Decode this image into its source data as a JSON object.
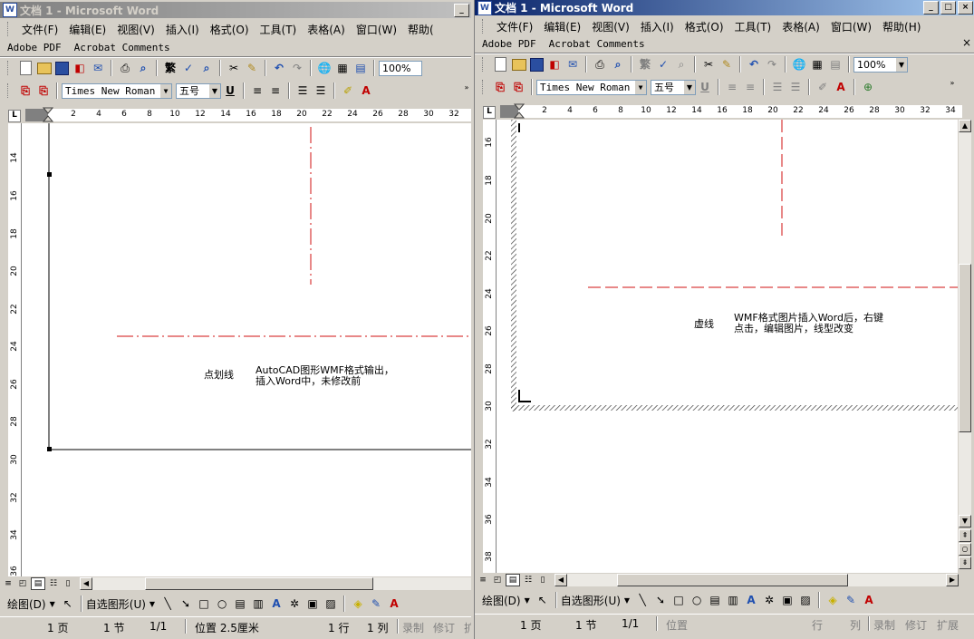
{
  "left_window": {
    "title": "文档 1 - Microsoft Word",
    "title_buttons": [
      "_"
    ],
    "menus": [
      "文件(F)",
      "编辑(E)",
      "视图(V)",
      "插入(I)",
      "格式(O)",
      "工具(T)",
      "表格(A)",
      "窗口(W)",
      "帮助("
    ],
    "adobe_items": [
      "Adobe PDF",
      "Acrobat Comments"
    ],
    "zoom": "100%",
    "font_name": "Times New Roman",
    "font_size": "五号",
    "ruler_numbers": [
      "2",
      "4",
      "6",
      "8",
      "10",
      "12",
      "14",
      "16",
      "18",
      "20",
      "22",
      "24",
      "26",
      "28",
      "30",
      "32"
    ],
    "vruler_numbers": [
      "14",
      "16",
      "18",
      "20",
      "22",
      "24",
      "26",
      "28",
      "30",
      "32",
      "34",
      "36"
    ],
    "annotation_label": "点划线",
    "annotation_lines": [
      "AutoCAD图形WMF格式输出，",
      "插入Word中，未修改前"
    ],
    "draw_menu": "绘图(D)",
    "autoshape_menu": "自选图形(U)",
    "status": {
      "page": "1 页",
      "section": "1 节",
      "pages": "1/1",
      "position": "位置 2.5厘米",
      "line": "1 行",
      "col": "1 列",
      "rec": "录制",
      "trk": "修订",
      "ext": "扩"
    }
  },
  "right_window": {
    "title": "文档 1 - Microsoft Word",
    "title_buttons": [
      "_",
      "□",
      "×"
    ],
    "menus": [
      "文件(F)",
      "编辑(E)",
      "视图(V)",
      "插入(I)",
      "格式(O)",
      "工具(T)",
      "表格(A)",
      "窗口(W)",
      "帮助(H)"
    ],
    "close_doc": "×",
    "adobe_items": [
      "Adobe PDF",
      "Acrobat Comments"
    ],
    "zoom": "100%",
    "font_name": "Times New Roman",
    "font_size": "五号",
    "ruler_numbers": [
      "2",
      "4",
      "6",
      "8",
      "10",
      "12",
      "14",
      "16",
      "18",
      "20",
      "22",
      "24",
      "26",
      "28",
      "30",
      "32",
      "34"
    ],
    "vruler_numbers": [
      "16",
      "18",
      "20",
      "22",
      "24",
      "26",
      "28",
      "30",
      "32",
      "34",
      "36",
      "38"
    ],
    "annotation_label": "虚线",
    "annotation_lines": [
      "WMF格式图片插入Word后，右键",
      "点击，编辑图片，线型改变"
    ],
    "draw_menu": "绘图(D)",
    "autoshape_menu": "自选图形(U)",
    "status": {
      "page": "1 页",
      "section": "1 节",
      "pages": "1/1",
      "position": "位置",
      "line": "行",
      "col": "列",
      "rec": "录制",
      "trk": "修订",
      "ext": "扩展"
    }
  },
  "colors": {
    "title_active": "#0a246a",
    "title_inactive": "#808080",
    "dash_line": "#d01010",
    "face": "#d4d0c8"
  }
}
